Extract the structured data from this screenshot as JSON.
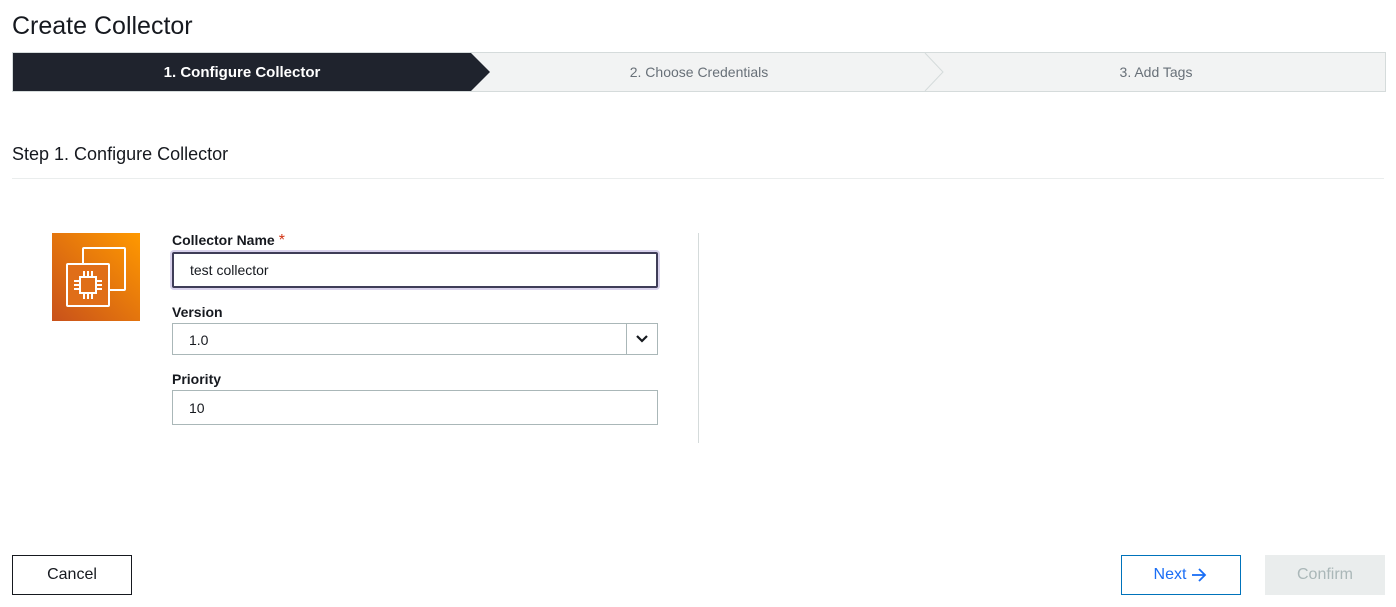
{
  "page": {
    "title": "Create Collector"
  },
  "stepper": {
    "steps": [
      {
        "label": "1. Configure Collector",
        "active": true
      },
      {
        "label": "2. Choose Credentials",
        "active": false
      },
      {
        "label": "3. Add Tags",
        "active": false
      }
    ]
  },
  "section": {
    "title": "Step 1. Configure Collector"
  },
  "logo": {
    "icon": "chip-icon",
    "colors": [
      "#c8511b",
      "#ff9900"
    ]
  },
  "form": {
    "collector_name": {
      "label": "Collector Name",
      "required_mark": "*",
      "value": "test collector"
    },
    "version": {
      "label": "Version",
      "value": "1.0",
      "icon": "chevron-down-icon"
    },
    "priority": {
      "label": "Priority",
      "value": "10"
    }
  },
  "footer": {
    "cancel_label": "Cancel",
    "next_label": "Next",
    "next_icon": "arrow-right-icon",
    "confirm_label": "Confirm"
  },
  "colors": {
    "active_step_bg": "#1f232d",
    "link_blue": "#1a6ef5",
    "required": "#d13212"
  }
}
